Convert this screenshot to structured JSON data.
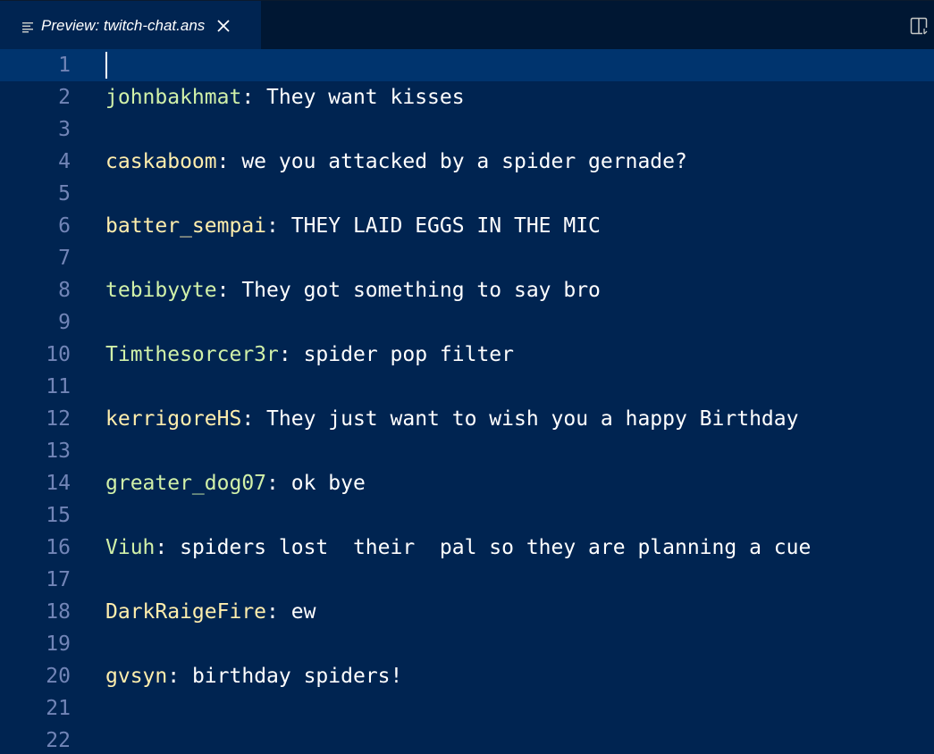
{
  "tab": {
    "title": "Preview: twitch-chat.ans",
    "icon": "preview-lines-icon",
    "close_icon": "close-icon"
  },
  "toolbar": {
    "split_icon": "split-editor-icon"
  },
  "colors": {
    "background": "#002451",
    "line_number": "#7285b7",
    "text": "#ffffff",
    "username_green": "#d1f1a9",
    "username_yellow": "#ffeead"
  },
  "line_numbers": [
    "1",
    "2",
    "3",
    "4",
    "5",
    "6",
    "7",
    "8",
    "9",
    "10",
    "11",
    "12",
    "13",
    "14",
    "15",
    "16",
    "17",
    "18",
    "19",
    "20",
    "21",
    "22"
  ],
  "messages": [
    {
      "line": "2",
      "user": "johnbakhmat",
      "sep": ": ",
      "text": "They want kisses",
      "color": "green"
    },
    {
      "line": "4",
      "user": "caskaboom",
      "sep": ": ",
      "text": "we you attacked by a spider gernade?",
      "color": "yellow"
    },
    {
      "line": "6",
      "user": "batter_sempai",
      "sep": ": ",
      "text": "THEY LAID EGGS IN THE MIC",
      "color": "yellow"
    },
    {
      "line": "8",
      "user": "tebibyyte",
      "sep": ": ",
      "text": "They got something to say bro",
      "color": "green"
    },
    {
      "line": "10",
      "user": "Timthesorcer3r",
      "sep": ": ",
      "text": "spider pop filter",
      "color": "green"
    },
    {
      "line": "12",
      "user": "kerrigoreHS",
      "sep": ": ",
      "text": "They just want to wish you a happy Birthday",
      "color": "yellow"
    },
    {
      "line": "14",
      "user": "greater_dog07",
      "sep": ": ",
      "text": "ok bye",
      "color": "green"
    },
    {
      "line": "16",
      "user": "Viuh",
      "sep": ": ",
      "text": "spiders lost  their  pal so they are planning a cue",
      "color": "green"
    },
    {
      "line": "18",
      "user": "DarkRaigeFire",
      "sep": ": ",
      "text": "ew",
      "color": "yellow"
    },
    {
      "line": "20",
      "user": "gvsyn",
      "sep": ": ",
      "text": "birthday spiders!",
      "color": "yellow"
    }
  ]
}
